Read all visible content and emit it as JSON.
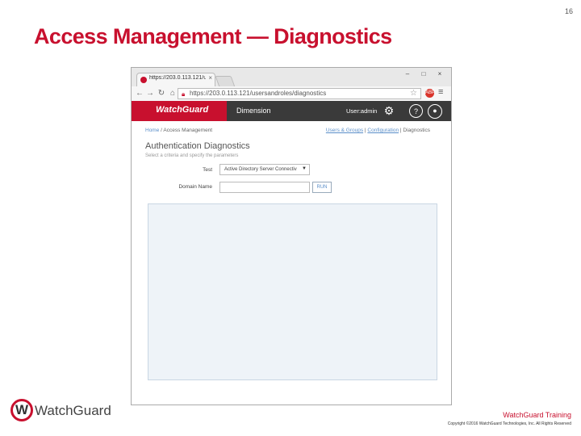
{
  "slide": {
    "number": "16",
    "title": "Access Management — Diagnostics"
  },
  "browser": {
    "tab_title": "https://203.0.113.121/usc",
    "url": "https://203.0.113.121/usersandroles/diagnostics",
    "window_controls": [
      "–",
      "□",
      "×"
    ],
    "ext_label": "ABP"
  },
  "app": {
    "brand": "WatchGuard",
    "name": "Dimension",
    "user_label": "User:admin"
  },
  "page": {
    "breadcrumb_home": "Home",
    "breadcrumb_sep": "/",
    "breadcrumb_current": "Access Management",
    "subnav": [
      "Users & Groups",
      "Configuration",
      "Diagnostics"
    ],
    "heading": "Authentication Diagnostics",
    "subheading": "Select a criteria and specify the parameters",
    "test_label": "Test",
    "test_value": "Active Directory Server Connectiv",
    "domain_label": "Domain Name",
    "domain_value": "",
    "run_label": "RUN"
  },
  "footer": {
    "logo_text": "WatchGuard",
    "training": "WatchGuard Training",
    "copyright": "Copyright ©2016 WatchGuard Technologies, Inc. All Rights Reserved"
  }
}
